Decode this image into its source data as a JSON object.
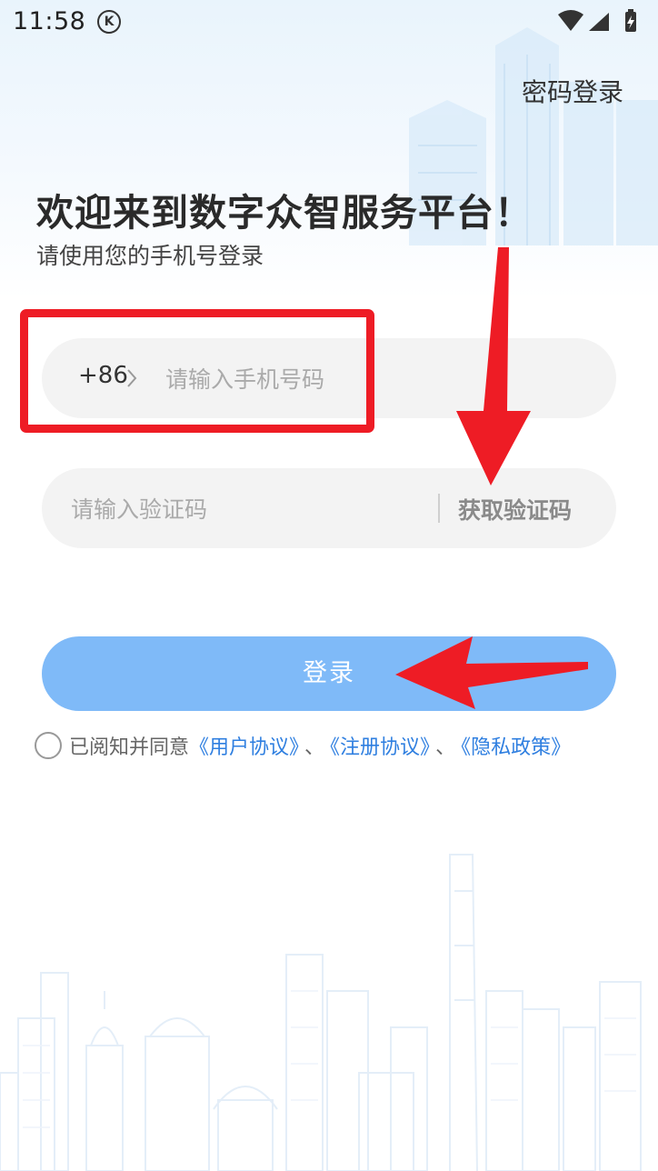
{
  "status_bar": {
    "time": "11:58",
    "k_badge": "K"
  },
  "header": {
    "password_login": "密码登录"
  },
  "welcome": {
    "title": "欢迎来到数字众智服务平台！",
    "subtitle": "请使用您的手机号登录"
  },
  "phone": {
    "country_code": "+86",
    "placeholder": "请输入手机号码",
    "value": ""
  },
  "code": {
    "placeholder": "请输入验证码",
    "value": "",
    "get_code_label": "获取验证码"
  },
  "login_button": {
    "label": "登录",
    "color": "#7fbaf8"
  },
  "agreement": {
    "prefix": "已阅知并同意",
    "user_agreement": "《用户协议》",
    "separator_1": "、",
    "register_agreement": "《注册协议》",
    "separator_2": "、",
    "privacy_policy": "《隐私政策》",
    "checked": false,
    "link_color": "#2f7fe0"
  },
  "annotations": {
    "highlight_color": "#ee1c25"
  },
  "icons": {
    "wifi": "wifi-icon",
    "signal": "signal-icon",
    "battery": "battery-charging-icon",
    "chevron": "chevron-right-icon"
  }
}
